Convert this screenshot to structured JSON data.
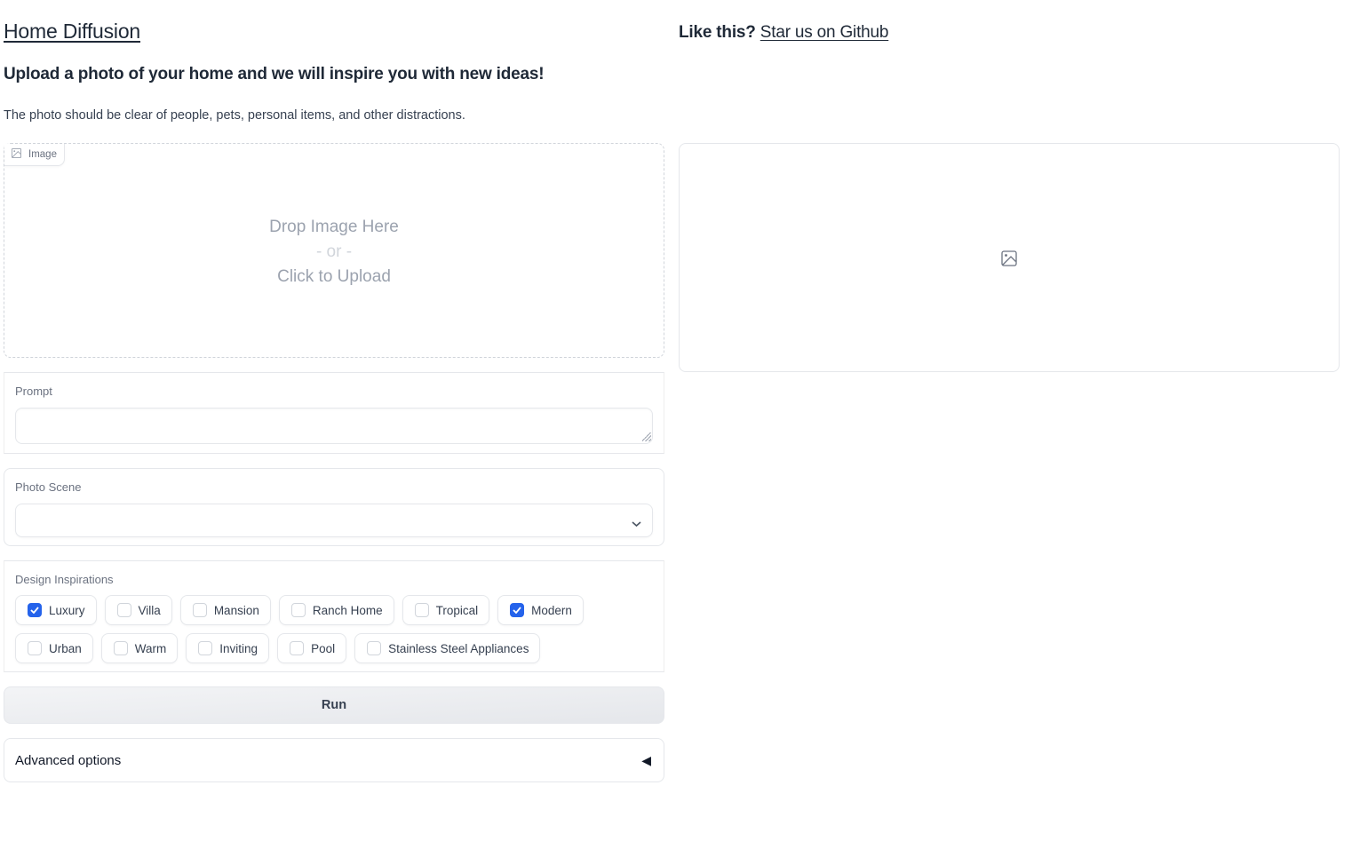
{
  "header": {
    "title": "Home Diffusion",
    "subtitle": "Upload a photo of your home and we will inspire you with new ideas!",
    "description": "The photo should be clear of people, pets, personal items, and other distractions.",
    "star_prefix": "Like this?",
    "star_link": "Star us on Github"
  },
  "upload": {
    "label": "Image",
    "label_icon": "image-icon",
    "drop_text": "Drop Image Here",
    "or_text": "- or -",
    "click_text": "Click to Upload"
  },
  "prompt": {
    "label": "Prompt",
    "value": "",
    "placeholder": ""
  },
  "photo_scene": {
    "label": "Photo Scene",
    "selected": "",
    "icon": "chevron-down-icon"
  },
  "design_inspirations": {
    "label": "Design Inspirations",
    "options": [
      {
        "label": "Luxury",
        "checked": true
      },
      {
        "label": "Villa",
        "checked": false
      },
      {
        "label": "Mansion",
        "checked": false
      },
      {
        "label": "Ranch Home",
        "checked": false
      },
      {
        "label": "Tropical",
        "checked": false
      },
      {
        "label": "Modern",
        "checked": true
      },
      {
        "label": "Urban",
        "checked": false
      },
      {
        "label": "Warm",
        "checked": false
      },
      {
        "label": "Inviting",
        "checked": false
      },
      {
        "label": "Pool",
        "checked": false
      },
      {
        "label": "Stainless Steel Appliances",
        "checked": false
      }
    ]
  },
  "run_button": {
    "label": "Run"
  },
  "advanced": {
    "label": "Advanced options",
    "arrow": "◀",
    "expanded": false
  },
  "output": {
    "icon": "image-placeholder-icon"
  },
  "colors": {
    "accent": "#2563eb",
    "border": "#e5e7eb",
    "muted_text": "#6b7280",
    "placeholder_text": "#9ca3af"
  }
}
